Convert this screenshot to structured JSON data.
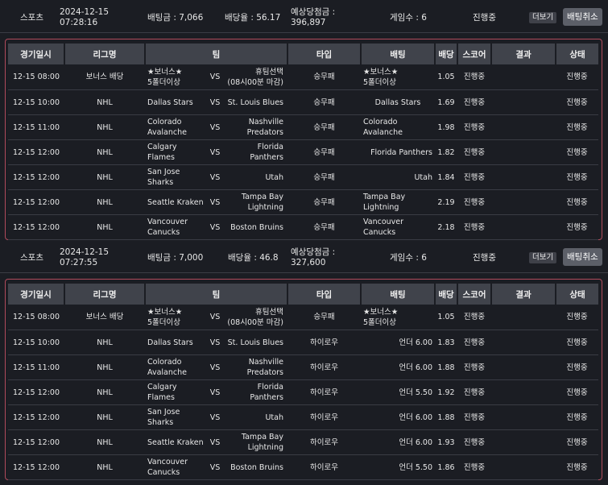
{
  "bets": [
    {
      "category": "스포츠",
      "date": "2024-12-15",
      "time": "07:28:16",
      "bet_amount": "배팅금 : 7,066",
      "odds": "배당율 : 56.17",
      "payout_label": "예상당첨금 :",
      "payout_value": "396,897",
      "games": "게임수 : 6",
      "status": "진행중",
      "more_label": "더보기",
      "cancel_label": "배팅취소",
      "headers": [
        "경기일시",
        "리그명",
        "팀",
        "타입",
        "배팅",
        "배당",
        "스코어",
        "결과",
        "상태"
      ],
      "rows": [
        {
          "date": "12-15 08:00",
          "league": "보너스 배당",
          "home1": "★보너스★",
          "home2": "5폴더이상",
          "vs": "VS",
          "away1": "휴팀선택",
          "away2": "(08시00분 마감)",
          "type": "승무패",
          "bet1": "★보너스★",
          "bet2": "5폴더이상",
          "bet_align": "lt",
          "odds": "1.05",
          "score": "진행중",
          "result": "",
          "state": "진행중"
        },
        {
          "date": "12-15 10:00",
          "league": "NHL",
          "home1": "Dallas Stars",
          "home2": "",
          "vs": "VS",
          "away1": "St. Louis Blues",
          "away2": "",
          "type": "승무패",
          "bet1": "Dallas Stars",
          "bet2": "",
          "bet_align": "ctr",
          "odds": "1.69",
          "score": "진행중",
          "result": "",
          "state": "진행중"
        },
        {
          "date": "12-15 11:00",
          "league": "NHL",
          "home1": "Colorado",
          "home2": "Avalanche",
          "vs": "VS",
          "away1": "Nashville",
          "away2": "Predators",
          "type": "승무패",
          "bet1": "Colorado",
          "bet2": "Avalanche",
          "bet_align": "lt",
          "odds": "1.98",
          "score": "진행중",
          "result": "",
          "state": "진행중"
        },
        {
          "date": "12-15 12:00",
          "league": "NHL",
          "home1": "Calgary Flames",
          "home2": "",
          "vs": "VS",
          "away1": "Florida Panthers",
          "away2": "",
          "type": "승무패",
          "bet1": "Florida Panthers",
          "bet2": "",
          "bet_align": "rt",
          "odds": "1.82",
          "score": "진행중",
          "result": "",
          "state": "진행중"
        },
        {
          "date": "12-15 12:00",
          "league": "NHL",
          "home1": "San Jose Sharks",
          "home2": "",
          "vs": "VS",
          "away1": "Utah",
          "away2": "",
          "type": "승무패",
          "bet1": "Utah",
          "bet2": "",
          "bet_align": "rt",
          "odds": "1.84",
          "score": "진행중",
          "result": "",
          "state": "진행중"
        },
        {
          "date": "12-15 12:00",
          "league": "NHL",
          "home1": "Seattle Kraken",
          "home2": "",
          "vs": "VS",
          "away1": "Tampa Bay",
          "away2": "Lightning",
          "type": "승무패",
          "bet1": "Tampa Bay",
          "bet2": "Lightning",
          "bet_align": "lt",
          "odds": "2.19",
          "score": "진행중",
          "result": "",
          "state": "진행중"
        },
        {
          "date": "12-15 12:00",
          "league": "NHL",
          "home1": "Vancouver",
          "home2": "Canucks",
          "vs": "VS",
          "away1": "Boston Bruins",
          "away2": "",
          "type": "승무패",
          "bet1": "Vancouver",
          "bet2": "Canucks",
          "bet_align": "lt",
          "odds": "2.18",
          "score": "진행중",
          "result": "",
          "state": "진행중"
        }
      ]
    },
    {
      "category": "스포츠",
      "date": "2024-12-15",
      "time": "07:27:55",
      "bet_amount": "배팅금 : 7,000",
      "odds": "배당율 : 46.8",
      "payout_label": "예상당첨금 :",
      "payout_value": "327,600",
      "games": "게임수 : 6",
      "status": "진행중",
      "more_label": "더보기",
      "cancel_label": "배팅취소",
      "headers": [
        "경기일시",
        "리그명",
        "팀",
        "타입",
        "배팅",
        "배당",
        "스코어",
        "결과",
        "상태"
      ],
      "rows": [
        {
          "date": "12-15 08:00",
          "league": "보너스 배당",
          "home1": "★보너스★",
          "home2": "5폴더이상",
          "vs": "VS",
          "away1": "휴팀선택",
          "away2": "(08시00분 마감)",
          "type": "승무패",
          "bet1": "★보너스★",
          "bet2": "5폴더이상",
          "bet_align": "lt",
          "odds": "1.05",
          "score": "진행중",
          "result": "",
          "state": "진행중"
        },
        {
          "date": "12-15 10:00",
          "league": "NHL",
          "home1": "Dallas Stars",
          "home2": "",
          "vs": "VS",
          "away1": "St. Louis Blues",
          "away2": "",
          "type": "하이로우",
          "bet1": "언더 6.00",
          "bet2": "",
          "bet_align": "rt",
          "odds": "1.83",
          "score": "진행중",
          "result": "",
          "state": "진행중"
        },
        {
          "date": "12-15 11:00",
          "league": "NHL",
          "home1": "Colorado",
          "home2": "Avalanche",
          "vs": "VS",
          "away1": "Nashville",
          "away2": "Predators",
          "type": "하이로우",
          "bet1": "언더 6.00",
          "bet2": "",
          "bet_align": "rt",
          "odds": "1.88",
          "score": "진행중",
          "result": "",
          "state": "진행중"
        },
        {
          "date": "12-15 12:00",
          "league": "NHL",
          "home1": "Calgary Flames",
          "home2": "",
          "vs": "VS",
          "away1": "Florida Panthers",
          "away2": "",
          "type": "하이로우",
          "bet1": "언더 5.50",
          "bet2": "",
          "bet_align": "rt",
          "odds": "1.92",
          "score": "진행중",
          "result": "",
          "state": "진행중"
        },
        {
          "date": "12-15 12:00",
          "league": "NHL",
          "home1": "San Jose Sharks",
          "home2": "",
          "vs": "VS",
          "away1": "Utah",
          "away2": "",
          "type": "하이로우",
          "bet1": "언더 6.00",
          "bet2": "",
          "bet_align": "rt",
          "odds": "1.88",
          "score": "진행중",
          "result": "",
          "state": "진행중"
        },
        {
          "date": "12-15 12:00",
          "league": "NHL",
          "home1": "Seattle Kraken",
          "home2": "",
          "vs": "VS",
          "away1": "Tampa Bay",
          "away2": "Lightning",
          "type": "하이로우",
          "bet1": "언더 6.00",
          "bet2": "",
          "bet_align": "rt",
          "odds": "1.93",
          "score": "진행중",
          "result": "",
          "state": "진행중"
        },
        {
          "date": "12-15 12:00",
          "league": "NHL",
          "home1": "Vancouver",
          "home2": "Canucks",
          "vs": "VS",
          "away1": "Boston Bruins",
          "away2": "",
          "type": "하이로우",
          "bet1": "언더 5.50",
          "bet2": "",
          "bet_align": "rt",
          "odds": "1.86",
          "score": "진행중",
          "result": "",
          "state": "진행중"
        }
      ]
    }
  ]
}
